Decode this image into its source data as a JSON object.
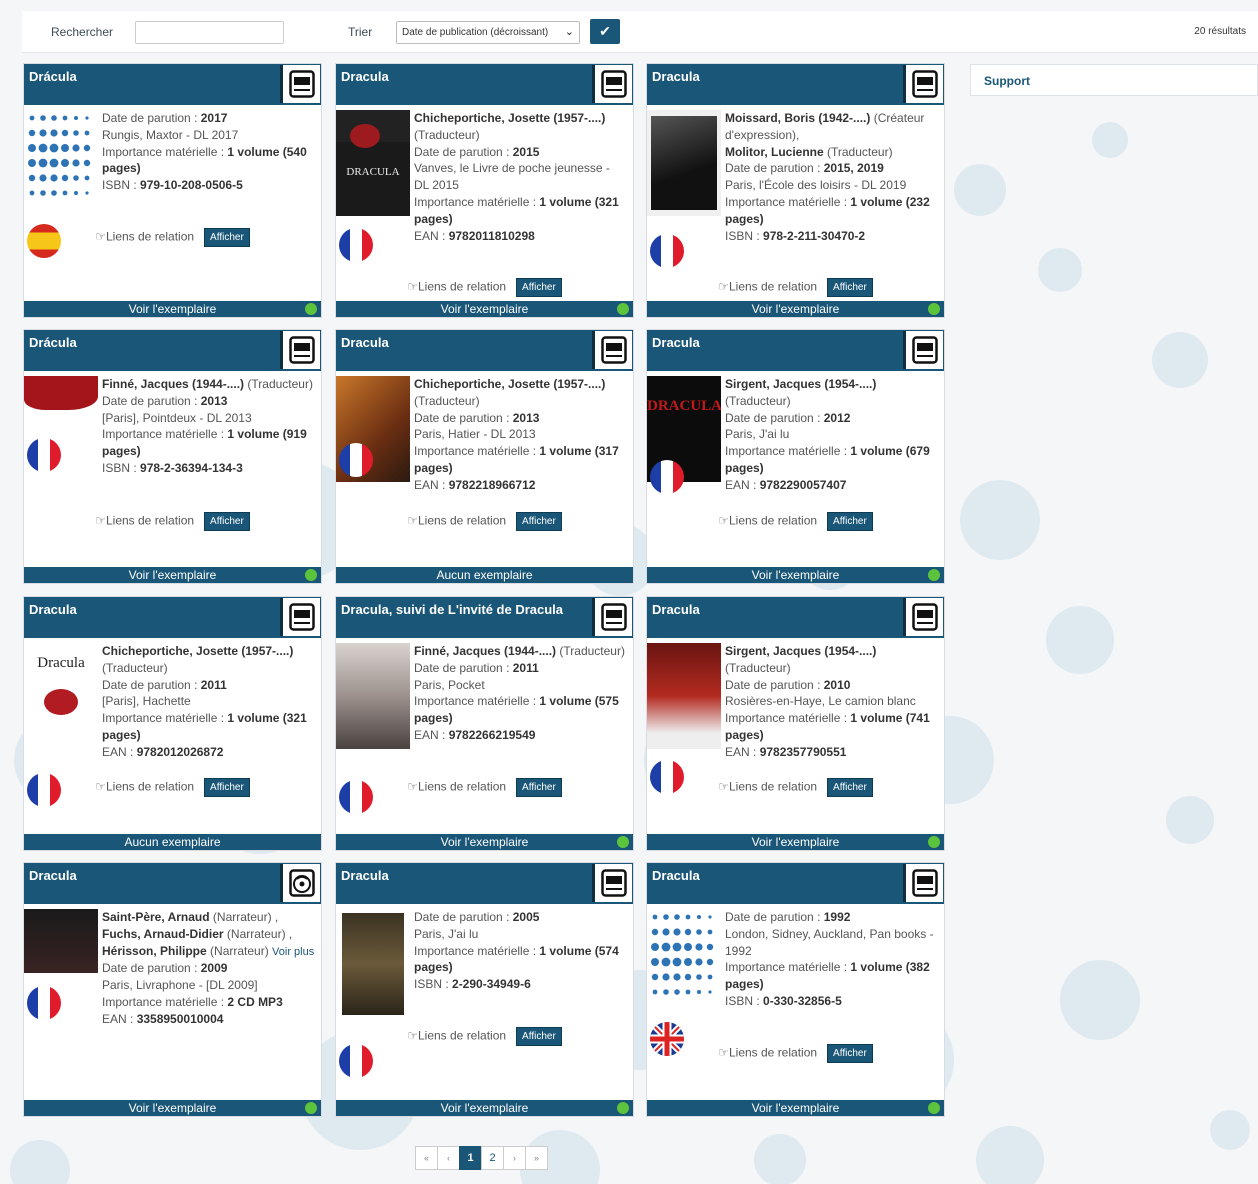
{
  "toolbar": {
    "search_label": "Rechercher",
    "search_value": "",
    "sort_label": "Trier",
    "sort_selected": "Date de publication (décroissant)",
    "results_count": "20 résultats"
  },
  "sidebar": {
    "support_label": "Support"
  },
  "labels": {
    "relation": "Liens de relation",
    "afficher": "Afficher",
    "date_parution": "Date de parution : ",
    "importance": "Importance matérielle : ",
    "voir_plus": "Voir plus"
  },
  "cards": [
    {
      "title": "Drácula",
      "type": "book",
      "flag": "es",
      "lines": [
        {
          "label": "Date de parution : ",
          "value": "2017"
        },
        {
          "text": "Rungis, Maxtor - DL 2017"
        },
        {
          "label": "Importance matérielle : ",
          "value": "1 volume (540 pages)"
        },
        {
          "label": "ISBN : ",
          "value": "979-10-208-0506-5"
        }
      ],
      "footer": "Voir l'exemplaire",
      "available": true
    },
    {
      "title": "Dracula",
      "type": "book",
      "flag": "fr",
      "lines": [
        {
          "value": "Chicheportiche, Josette (1957-....)",
          "text": " (Traducteur)"
        },
        {
          "label": "Date de parution : ",
          "value": "2015"
        },
        {
          "text": "Vanves, le Livre de poche jeunesse - DL 2015"
        },
        {
          "label": "Importance matérielle : ",
          "value": " 1 volume (321 pages)"
        },
        {
          "label": "EAN : ",
          "value": "9782011810298"
        }
      ],
      "footer": "Voir l'exemplaire",
      "available": true
    },
    {
      "title": "Dracula",
      "type": "book",
      "flag": "fr",
      "lines": [
        {
          "value": "Moissard, Boris (1942-....)",
          "text": " (Créateur d'expression), "
        },
        {
          "value": "Molitor, Lucienne",
          "text": " (Traducteur)"
        },
        {
          "label": "Date de parution : ",
          "value": "2015,  2019"
        },
        {
          "text": "Paris, l'École des loisirs - DL 2019"
        },
        {
          "label": "Importance matérielle : ",
          "value": "1 volume (232 pages)"
        },
        {
          "label": "ISBN : ",
          "value": "978-2-211-30470-2"
        }
      ],
      "footer": "Voir l'exemplaire",
      "available": true
    },
    {
      "title": "Drácula",
      "type": "book",
      "flag": "fr",
      "lines": [
        {
          "value": "Finné, Jacques (1944-....)",
          "text": " (Traducteur)"
        },
        {
          "label": "Date de parution : ",
          "value": "2013"
        },
        {
          "text": "[Paris], Pointdeux - DL 2013"
        },
        {
          "label": "Importance matérielle : ",
          "value": "1 volume (919 pages)"
        },
        {
          "label": "ISBN : ",
          "value": "978-2-36394-134-3"
        }
      ],
      "footer": "Voir l'exemplaire",
      "available": true
    },
    {
      "title": "Dracula",
      "type": "book",
      "flag": "fr",
      "lines": [
        {
          "value": "Chicheportiche, Josette (1957-....)",
          "text": " (Traducteur)"
        },
        {
          "label": "Date de parution : ",
          "value": "2013"
        },
        {
          "text": "Paris, Hatier - DL 2013"
        },
        {
          "label": "Importance matérielle : ",
          "value": "1 volume (317 pages)"
        },
        {
          "label": "EAN : ",
          "value": "9782218966712"
        }
      ],
      "footer": "Aucun exemplaire",
      "available": false
    },
    {
      "title": "Dracula",
      "type": "book",
      "flag": "fr",
      "lines": [
        {
          "value": "Sirgent, Jacques (1954-....)",
          "text": " (Traducteur)"
        },
        {
          "label": "Date de parution : ",
          "value": "2012"
        },
        {
          "text": "Paris, J'ai lu"
        },
        {
          "label": "Importance matérielle : ",
          "value": "1 volume (679 pages)"
        },
        {
          "label": "EAN : ",
          "value": "9782290057407"
        }
      ],
      "footer": "Voir l'exemplaire",
      "available": true
    },
    {
      "title": "Dracula",
      "type": "book",
      "flag": "fr",
      "lines": [
        {
          "value": "Chicheportiche, Josette (1957-....)",
          "text": " (Traducteur)"
        },
        {
          "label": "Date de parution : ",
          "value": "2011"
        },
        {
          "text": "[Paris], Hachette"
        },
        {
          "label": "Importance matérielle : ",
          "value": "1 volume (321 pages)"
        },
        {
          "label": "EAN : ",
          "value": "9782012026872"
        }
      ],
      "footer": "Aucun exemplaire",
      "available": false
    },
    {
      "title": "Dracula, suivi de L'invité de Dracula",
      "type": "book",
      "flag": "fr",
      "lines": [
        {
          "value": "Finné, Jacques (1944-....)",
          "text": " (Traducteur)"
        },
        {
          "label": "Date de parution : ",
          "value": "2011"
        },
        {
          "text": "Paris, Pocket"
        },
        {
          "label": "Importance matérielle : ",
          "value": "1 volume (575 pages)"
        },
        {
          "label": "EAN : ",
          "value": "9782266219549"
        }
      ],
      "footer": "Voir l'exemplaire",
      "available": true
    },
    {
      "title": "Dracula",
      "type": "book",
      "flag": "fr",
      "lines": [
        {
          "value": "Sirgent, Jacques (1954-....)",
          "text": " (Traducteur)"
        },
        {
          "label": "Date de parution : ",
          "value": "2010"
        },
        {
          "text": "Rosières-en-Haye, Le camion blanc"
        },
        {
          "label": "Importance matérielle : ",
          "value": "1 volume (741 pages)"
        },
        {
          "label": "EAN : ",
          "value": "9782357790551"
        }
      ],
      "footer": "Voir l'exemplaire",
      "available": true
    },
    {
      "title": "Dracula",
      "type": "audio",
      "flag": "fr",
      "lines": [
        {
          "value": "Saint-Père, Arnaud",
          "text": " (Narrateur) , ",
          "value2": "Fuchs, Arnaud-Didier",
          "text2": " (Narrateur) , ",
          "value3": "Hérisson, Philippe",
          "text3": " (Narrateur) ",
          "more": "Voir plus"
        },
        {
          "label": "Date de parution : ",
          "value": "2009"
        },
        {
          "text": "Paris, Livraphone - [DL 2009]"
        },
        {
          "label": "Importance matérielle : ",
          "value": "2 CD MP3"
        },
        {
          "label": "EAN : ",
          "value": "3358950010004"
        }
      ],
      "footer": "Voir l'exemplaire",
      "available": true
    },
    {
      "title": "Dracula",
      "type": "book",
      "flag": "fr",
      "lines": [
        {
          "label": "Date de parution : ",
          "value": "2005"
        },
        {
          "text": "Paris, J'ai lu"
        },
        {
          "label": "Importance matérielle : ",
          "value": "1 volume (574 pages)"
        },
        {
          "label": "ISBN : ",
          "value": "2-290-34949-6"
        }
      ],
      "footer": "Voir l'exemplaire",
      "available": true
    },
    {
      "title": "Dracula",
      "type": "book",
      "flag": "gb",
      "lines": [
        {
          "label": "Date de parution : ",
          "value": "1992"
        },
        {
          "text": " London, Sidney, Auckland, Pan books - 1992"
        },
        {
          "label": "Importance matérielle : ",
          "value": "1 volume (382 pages)"
        },
        {
          "label": "ISBN : ",
          "value": " 0-330-32856-5"
        }
      ],
      "footer": "Voir l'exemplaire",
      "available": true
    }
  ],
  "pagination": {
    "first": "«",
    "prev": "‹",
    "pages": [
      "1",
      "2"
    ],
    "current": "1",
    "next": "›",
    "last": "»"
  },
  "colors": {
    "brand": "#1a5677",
    "available": "#5cc33d"
  }
}
